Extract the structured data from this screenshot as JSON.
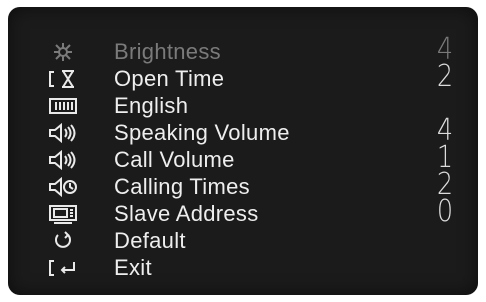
{
  "menu": {
    "items": [
      {
        "label": "Brightness",
        "value": "4",
        "icon": "sun-icon",
        "selected": true
      },
      {
        "label": "Open Time",
        "value": "2",
        "icon": "hourglass-bracket-icon"
      },
      {
        "label": "English",
        "value": "",
        "icon": "language-icon"
      },
      {
        "label": "Speaking Volume",
        "value": "4",
        "icon": "speaker-icon"
      },
      {
        "label": "Call Volume",
        "value": "1",
        "icon": "call-speaker-icon"
      },
      {
        "label": "Calling Times",
        "value": "2",
        "icon": "speaker-clock-icon"
      },
      {
        "label": "Slave Address",
        "value": "0",
        "icon": "device-icon"
      },
      {
        "label": "Default",
        "value": "",
        "icon": "reset-icon"
      },
      {
        "label": "Exit",
        "value": "",
        "icon": "exit-icon"
      }
    ]
  },
  "colors": {
    "screen": "#1b1b1b",
    "text": "#eeeeee",
    "selected_text": "#7a7a7a"
  }
}
